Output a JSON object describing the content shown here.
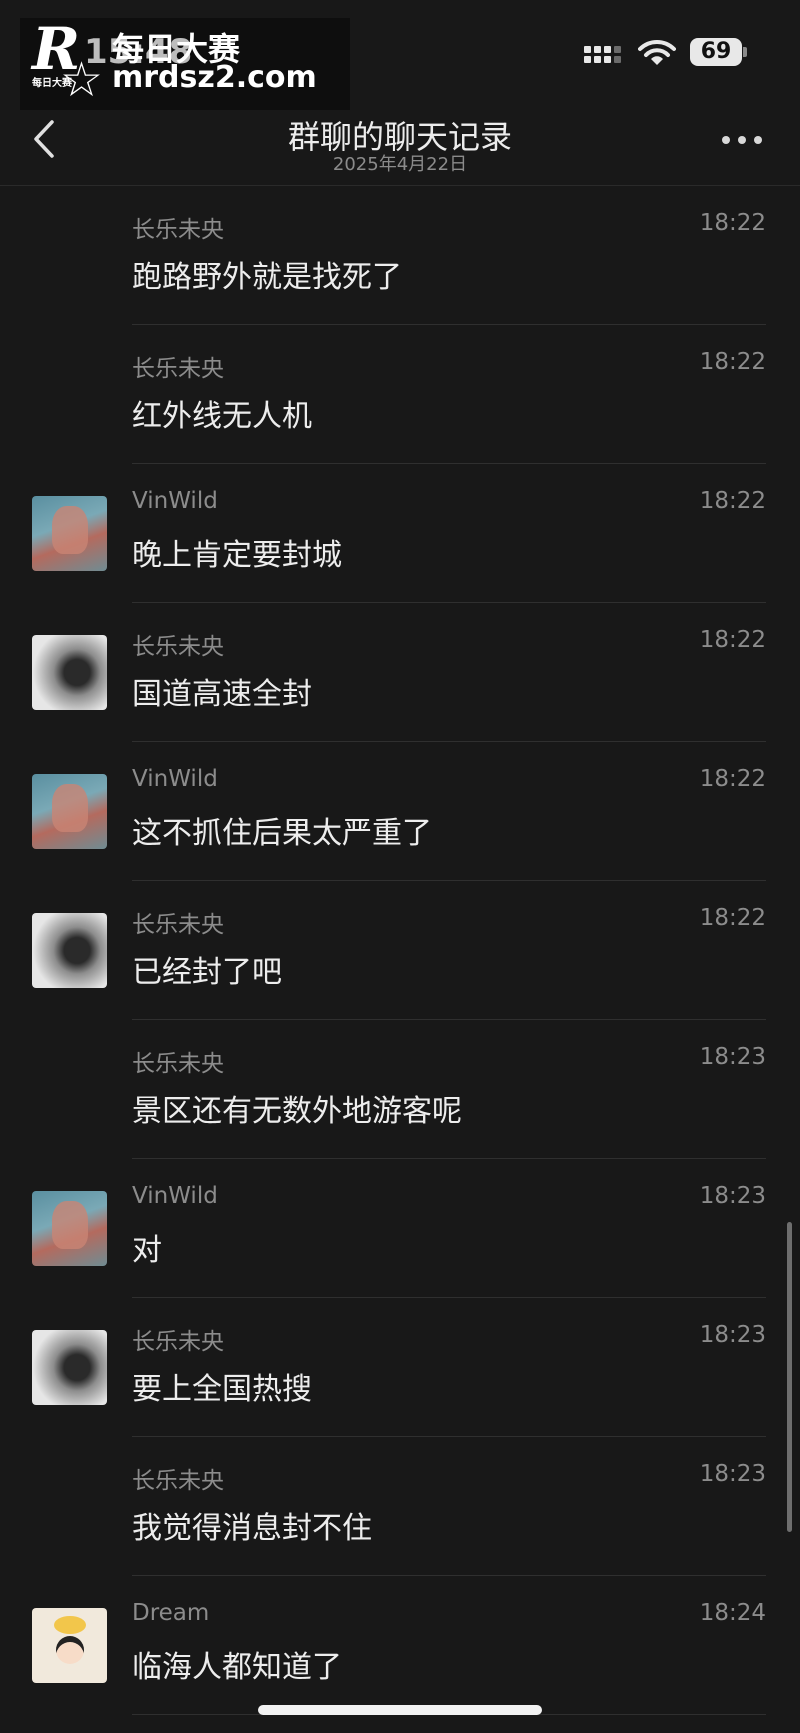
{
  "status_bar": {
    "time": "15:48",
    "battery": "69",
    "icons": [
      "signal-icon",
      "wifi-icon",
      "battery-icon"
    ]
  },
  "watermark": {
    "logo_letter": "R",
    "logo_small": "每日大赛",
    "top_text": "每日大赛",
    "url": "mrdsz2.com"
  },
  "header": {
    "title": "群聊的聊天记录",
    "subtitle": "2025年4月22日",
    "icons": [
      "back-chevron-icon",
      "more-options-icon"
    ]
  },
  "messages": [
    {
      "sender": "长乐未央",
      "time": "18:22",
      "text": "跑路野外就是找死了",
      "avatar": ""
    },
    {
      "sender": "长乐未央",
      "time": "18:22",
      "text": "红外线无人机",
      "avatar": ""
    },
    {
      "sender": "VinWild",
      "time": "18:22",
      "text": "晚上肯定要封城",
      "avatar": "vin"
    },
    {
      "sender": "长乐未央",
      "time": "18:22",
      "text": "国道高速全封",
      "avatar": "chang"
    },
    {
      "sender": "VinWild",
      "time": "18:22",
      "text": "这不抓住后果太严重了",
      "avatar": "vin"
    },
    {
      "sender": "长乐未央",
      "time": "18:22",
      "text": "已经封了吧",
      "avatar": "chang"
    },
    {
      "sender": "长乐未央",
      "time": "18:23",
      "text": "景区还有无数外地游客呢",
      "avatar": ""
    },
    {
      "sender": "VinWild",
      "time": "18:23",
      "text": "对",
      "avatar": "vin"
    },
    {
      "sender": "长乐未央",
      "time": "18:23",
      "text": "要上全国热搜",
      "avatar": "chang"
    },
    {
      "sender": "长乐未央",
      "time": "18:23",
      "text": "我觉得消息封不住",
      "avatar": ""
    },
    {
      "sender": "Dream",
      "time": "18:24",
      "text": "临海人都知道了",
      "avatar": "dream"
    }
  ],
  "colors": {
    "background": "#181818",
    "text_primary": "#ededed",
    "text_secondary": "#8c8c8c",
    "divider": "#2f2f2f"
  }
}
